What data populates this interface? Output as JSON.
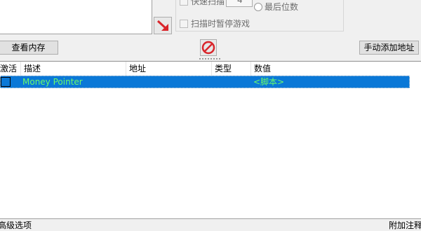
{
  "scan_options": {
    "fast_scan_label": "快速扫描",
    "last_digits_label": "最后位数",
    "pause_game_label": "扫描时暂停游戏",
    "fast_scan_value": "4"
  },
  "buttons": {
    "view_memory": "查看内存",
    "add_address_manually": "手动添加地址"
  },
  "table": {
    "headers": [
      "激活",
      "描述",
      "地址",
      "类型",
      "数值"
    ],
    "rows": [
      {
        "active": "",
        "description": "Money Pointer",
        "address": "",
        "type": "",
        "value": "<脚本>"
      }
    ]
  },
  "footer": {
    "advanced_options": "高级选项",
    "table_extras": "附加注释"
  },
  "colors": {
    "selection": "#0a78d7",
    "row_text": "#6bfb6b",
    "stop_icon": "#d9252b",
    "arrow_icon": "#d9252b"
  },
  "icons": [
    "red-arrow-icon",
    "stop-icon"
  ]
}
